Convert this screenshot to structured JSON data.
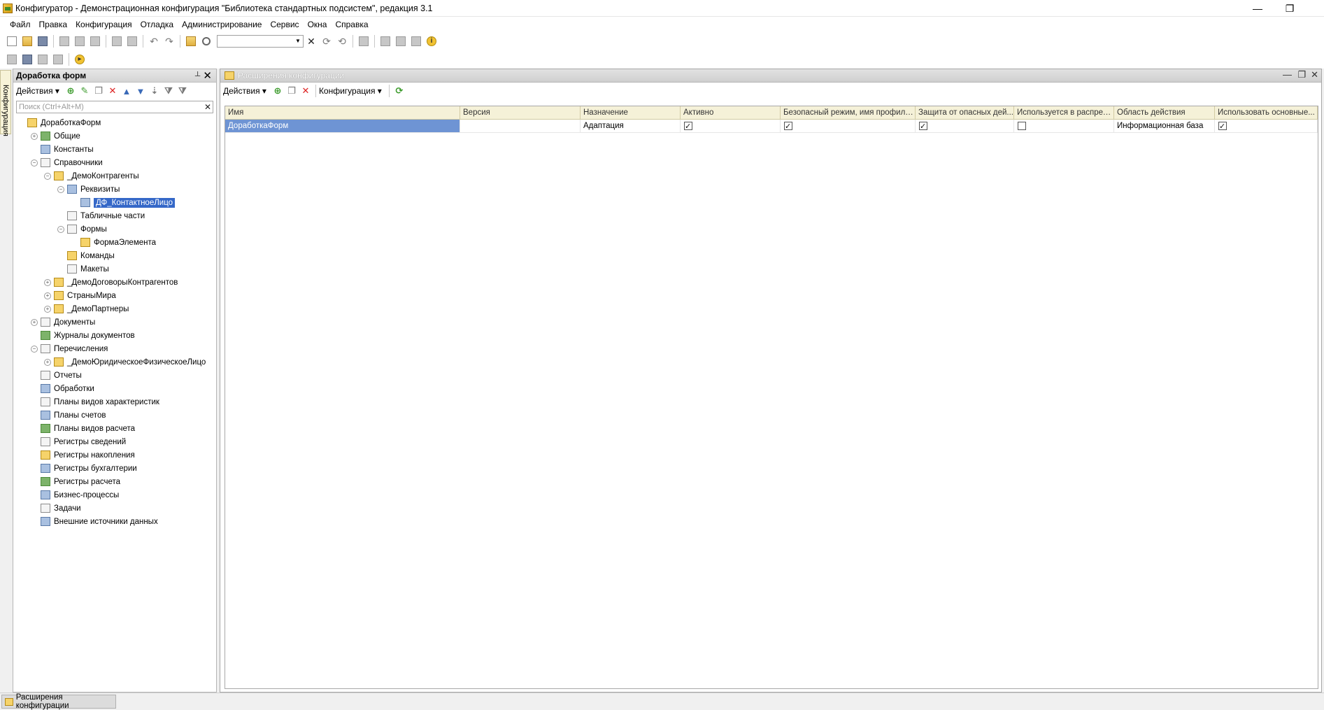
{
  "window": {
    "title": "Конфигуратор - Демонстрационная конфигурация \"Библиотека стандартных подсистем\", редакция 3.1",
    "minimize": "—",
    "restore": "❐"
  },
  "menu": [
    "Файл",
    "Правка",
    "Конфигурация",
    "Отладка",
    "Администрирование",
    "Сервис",
    "Окна",
    "Справка"
  ],
  "left_vtab": "Конфигурация",
  "left_panel": {
    "title": "Доработка форм",
    "actions": "Действия",
    "search_placeholder": "Поиск (Ctrl+Alt+M)",
    "tree": [
      {
        "label": "ДоработкаФорм",
        "level": 0,
        "exp": "",
        "icon": "y"
      },
      {
        "label": "Общие",
        "level": 1,
        "exp": "+",
        "icon": "g"
      },
      {
        "label": "Константы",
        "level": 1,
        "exp": "",
        "icon": "b"
      },
      {
        "label": "Справочники",
        "level": 1,
        "exp": "−",
        "icon": ""
      },
      {
        "label": "_ДемоКонтрагенты",
        "level": 2,
        "exp": "−",
        "icon": "y"
      },
      {
        "label": "Реквизиты",
        "level": 3,
        "exp": "−",
        "icon": "b"
      },
      {
        "label": "ДФ_КонтактноеЛицо",
        "level": 4,
        "exp": "",
        "icon": "b",
        "selected": true
      },
      {
        "label": "Табличные части",
        "level": 3,
        "exp": "",
        "icon": ""
      },
      {
        "label": "Формы",
        "level": 3,
        "exp": "−",
        "icon": ""
      },
      {
        "label": "ФормаЭлемента",
        "level": 4,
        "exp": "",
        "icon": "y"
      },
      {
        "label": "Команды",
        "level": 3,
        "exp": "",
        "icon": "y"
      },
      {
        "label": "Макеты",
        "level": 3,
        "exp": "",
        "icon": ""
      },
      {
        "label": "_ДемоДоговорыКонтрагентов",
        "level": 2,
        "exp": "+",
        "icon": "y"
      },
      {
        "label": "СтраныМира",
        "level": 2,
        "exp": "+",
        "icon": "y"
      },
      {
        "label": "_ДемоПартнеры",
        "level": 2,
        "exp": "+",
        "icon": "y"
      },
      {
        "label": "Документы",
        "level": 1,
        "exp": "+",
        "icon": ""
      },
      {
        "label": "Журналы документов",
        "level": 1,
        "exp": "",
        "icon": "g"
      },
      {
        "label": "Перечисления",
        "level": 1,
        "exp": "−",
        "icon": ""
      },
      {
        "label": "_ДемоЮридическоеФизическоеЛицо",
        "level": 2,
        "exp": "+",
        "icon": "y"
      },
      {
        "label": "Отчеты",
        "level": 1,
        "exp": "",
        "icon": ""
      },
      {
        "label": "Обработки",
        "level": 1,
        "exp": "",
        "icon": "b"
      },
      {
        "label": "Планы видов характеристик",
        "level": 1,
        "exp": "",
        "icon": ""
      },
      {
        "label": "Планы счетов",
        "level": 1,
        "exp": "",
        "icon": "b"
      },
      {
        "label": "Планы видов расчета",
        "level": 1,
        "exp": "",
        "icon": "g"
      },
      {
        "label": "Регистры сведений",
        "level": 1,
        "exp": "",
        "icon": ""
      },
      {
        "label": "Регистры накопления",
        "level": 1,
        "exp": "",
        "icon": "y"
      },
      {
        "label": "Регистры бухгалтерии",
        "level": 1,
        "exp": "",
        "icon": "b"
      },
      {
        "label": "Регистры расчета",
        "level": 1,
        "exp": "",
        "icon": "g"
      },
      {
        "label": "Бизнес-процессы",
        "level": 1,
        "exp": "",
        "icon": "b"
      },
      {
        "label": "Задачи",
        "level": 1,
        "exp": "",
        "icon": ""
      },
      {
        "label": "Внешние источники данных",
        "level": 1,
        "exp": "",
        "icon": "b"
      }
    ]
  },
  "ext_window": {
    "title": "Расширения конфигурации",
    "actions": "Действия",
    "configuration": "Конфигурация",
    "columns": [
      "Имя",
      "Версия",
      "Назначение",
      "Активно",
      "Безопасный режим, имя профиля ...",
      "Защита от опасных дей...",
      "Используется в распред...",
      "Область действия",
      "Использовать основные..."
    ],
    "rows": [
      {
        "name": "ДоработкаФорм",
        "version": "",
        "purpose": "Адаптация",
        "active": true,
        "safe_mode": true,
        "protection": true,
        "distributed": false,
        "scope": "Информационная база",
        "use_main": true
      }
    ]
  },
  "taskbar": {
    "tab": "Расширения конфигурации"
  }
}
